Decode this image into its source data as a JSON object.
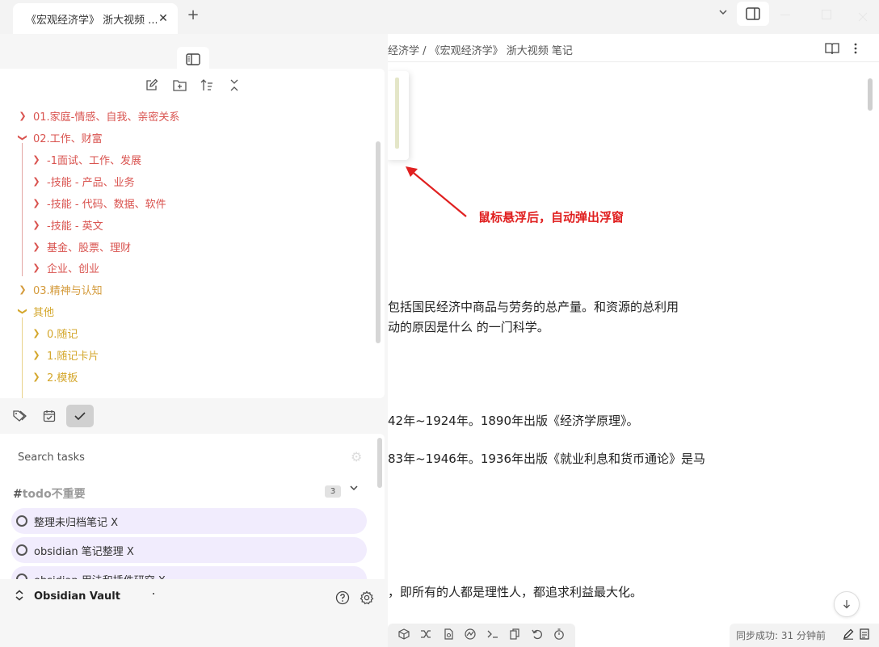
{
  "tab": {
    "title": "《宏观经济学》 浙大视频 ...",
    "close": "✕",
    "new": "+"
  },
  "editor": {
    "breadcrumb": "经济学 / 《宏观经济学》 浙大视频 笔记",
    "lines": [
      "包括国民经济中商品与劳务的总产量。和资源的总利用",
      "动的原因是什么 的一门科学。",
      "42年~1924年。1890年出版《经济学原理》。",
      "83年~1946年。1936年出版《就业利息和货币通论》是马",
      "，即所有的人都是理性人，都追求利益最大化。"
    ]
  },
  "annotation": {
    "text": "鼠标悬浮后，自动弹出浮窗",
    "color": "#e02020"
  },
  "file_tree": {
    "items": [
      {
        "label": "01.家庭-情感、自我、亲密关系",
        "expanded": false,
        "color": "#d9534f"
      },
      {
        "label": "02.工作、财富",
        "expanded": true,
        "color": "#d9534f"
      },
      {
        "label": "-1面试、工作、发展",
        "expanded": false,
        "color": "#d9534f"
      },
      {
        "label": "-技能 - 产品、业务",
        "expanded": false,
        "color": "#d9534f"
      },
      {
        "label": "-技能 - 代码、数据、软件",
        "expanded": false,
        "color": "#d9534f"
      },
      {
        "label": "-技能 - 英文",
        "expanded": false,
        "color": "#d9534f"
      },
      {
        "label": "基金、股票、理财",
        "expanded": false,
        "color": "#d9534f"
      },
      {
        "label": "企业、创业",
        "expanded": false,
        "color": "#d9534f"
      },
      {
        "label": "03.精神与认知",
        "expanded": false,
        "color": "#d49a3a"
      },
      {
        "label": "其他",
        "expanded": true,
        "color": "#d4a72c"
      },
      {
        "label": "0.随记",
        "expanded": false,
        "color": "#d4a72c"
      },
      {
        "label": "1.随记卡片",
        "expanded": false,
        "color": "#d4a72c"
      },
      {
        "label": "2.模板",
        "expanded": false,
        "color": "#d4a72c"
      }
    ]
  },
  "tasks": {
    "search_placeholder": "Search tasks",
    "group": {
      "hash": "#",
      "name": "todo不重要",
      "count": "3"
    },
    "items": [
      "整理未归档笔记 X",
      "obsidian 笔记整理 X",
      "obsidian 用法和插件研究 X"
    ]
  },
  "vault": {
    "name": "Obsidian Vault"
  },
  "status": {
    "sync": "同步成功: 31 分钟前"
  }
}
